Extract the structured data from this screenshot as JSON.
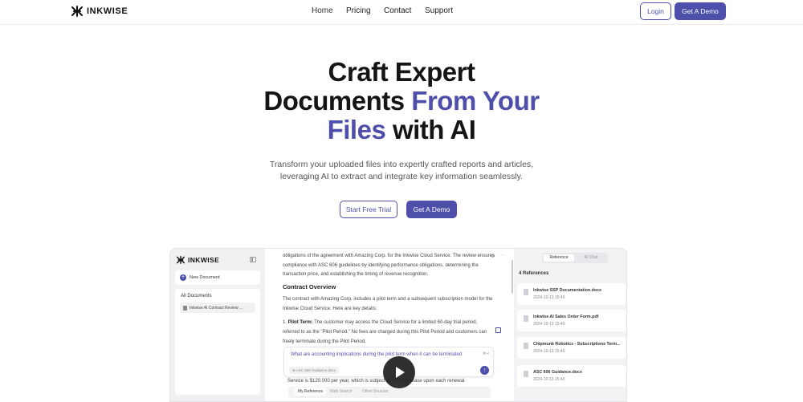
{
  "nav": {
    "brand": "INKWISE",
    "links": [
      "Home",
      "Pricing",
      "Contact",
      "Support"
    ],
    "login_label": "Login",
    "demo_label": "Get A Demo"
  },
  "hero": {
    "title_line1": "Craft Expert",
    "title_line2_a": "Documents ",
    "title_line2_b": "From Your",
    "title_line3_a": "Files",
    "title_line3_b": " with AI",
    "subtitle_line1": "Transform your uploaded files into expertly crafted reports and articles,",
    "subtitle_line2": "leveraging AI to extract and integrate key information seamlessly.",
    "trial_label": "Start Free Trial",
    "demo_label": "Get A Demo"
  },
  "app": {
    "brand": "INKWISE",
    "new_document": "New Document",
    "all_documents": "All Documents",
    "doc_item": "Inkwise AI Contract Review ...",
    "intro_text": "obligations of the agreement with Amazing Corp. for the Inkwise Cloud Service. The review ensures compliance with ASC 606 guidelines by identifying performance obligations, determining the transaction price, and establishing the timing of revenue recognition.",
    "heading": "Contract Overview",
    "overview_text": "The contract with Amazing Corp. includes a pilot term and a subsequent subscription model for the Inkwise Cloud Service. Here are key details:",
    "list_num": "1.",
    "list_label": "Pilot Term:",
    "list_text": " The customer may access the Cloud Service for a limited 60-day trial period, referred to as the \"Pilot Period.\" No fees are charged during this Pilot Period and customers can freely terminate during the Pilot Period.",
    "ask_question": "What are accounting implications during the pilot term when it can be terminated",
    "ask_file": "ASC 606 Guidance.docx",
    "ask_kbd": "⌘⏎",
    "under_text": "Service is $120,000 per year, which is subject to a 5% increase upon each renewal.",
    "source_tabs": [
      "My Reference",
      "Web Search",
      "Other Sources"
    ],
    "right_tabs": [
      "Reference",
      "AI Chat"
    ],
    "refs_title": "4 References",
    "references": [
      {
        "name": "Inkwise SSP Documentation.docx",
        "date": "2024-10-13 15:40"
      },
      {
        "name": "Inkwise AI Sales Order Form.pdf",
        "date": "2024-10-13 15:40"
      },
      {
        "name": "Chipmunk Robotics - Subscriptions Term...",
        "date": "2024-10-13 15:40"
      },
      {
        "name": "ASC 606 Guidance.docx",
        "date": "2024-10-13 15:40"
      }
    ]
  },
  "colors": {
    "accent": "#4e4fab",
    "text": "#151515"
  }
}
